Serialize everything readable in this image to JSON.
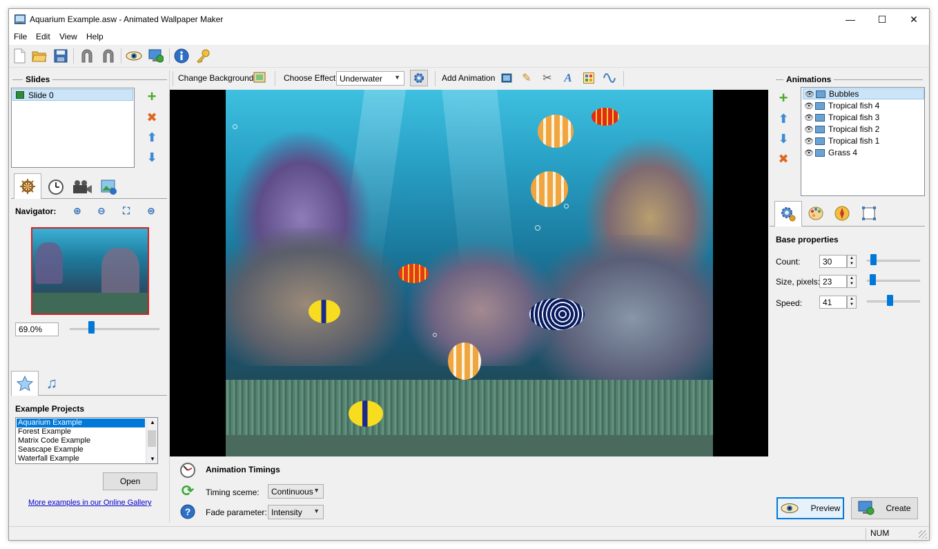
{
  "window": {
    "title": "Aquarium Example.asw - Animated Wallpaper Maker",
    "minimize_glyph": "—",
    "maximize_glyph": "☐",
    "close_glyph": "✕"
  },
  "menu": [
    "File",
    "Edit",
    "View",
    "Help"
  ],
  "toolbar": {
    "icons": [
      "new-file-icon",
      "open-folder-icon",
      "save-icon",
      "undo-icon",
      "redo-icon",
      "preview-eye-icon",
      "monitor-icon",
      "info-icon",
      "key-icon"
    ]
  },
  "slides": {
    "title": "Slides",
    "items": [
      "Slide 0"
    ]
  },
  "navigator": {
    "label": "Navigator:",
    "zoom_value": "69.0%",
    "zoom_fraction": 0.25
  },
  "examples": {
    "title": "Example Projects",
    "items": [
      "Aquarium Example",
      "Forest Example",
      "Matrix Code Example",
      "Seascape Example",
      "Waterfall Example"
    ],
    "selected": 0,
    "open_label": "Open",
    "gallery_link": "More examples in our Online Gallery"
  },
  "effects_bar": {
    "change_background": "Change Background",
    "choose_effect_label": "Choose Effect:",
    "effect_value": "Underwater",
    "add_animation": "Add Animation"
  },
  "timings": {
    "title": "Animation Timings",
    "timing_label": "Timing sceme:",
    "timing_value": "Continuous",
    "fade_label": "Fade parameter:",
    "fade_value": "Intensity"
  },
  "animations": {
    "title": "Animations",
    "items": [
      "Bubbles",
      "Tropical fish 4",
      "Tropical fish 3",
      "Tropical fish 2",
      "Tropical fish 1",
      "Grass 4"
    ],
    "selected": 0
  },
  "base_properties": {
    "title": "Base properties",
    "count_label": "Count:",
    "count_value": "30",
    "size_label": "Size, pixels:",
    "size_value": "23",
    "speed_label": "Speed:",
    "speed_value": "41"
  },
  "actions": {
    "preview": "Preview",
    "create": "Create"
  },
  "status": {
    "num": "NUM"
  }
}
